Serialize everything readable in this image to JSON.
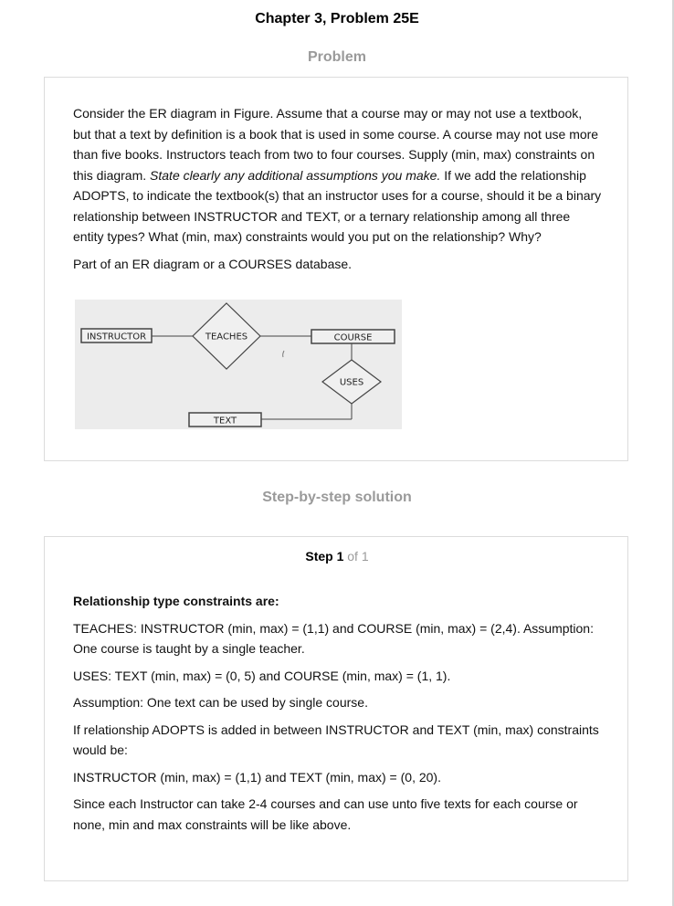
{
  "page": {
    "chapter_title": "Chapter 3, Problem 25E"
  },
  "problem": {
    "heading": "Problem",
    "text_before_italic": "Consider the ER diagram in Figure. Assume that a course may or may not use a textbook, but that a text by definition is a book that is used in some course. A course may not use more than five books. Instructors teach from two to four courses. Supply (min, max) constraints on this diagram. ",
    "text_italic": "State clearly any additional assumptions you make.",
    "text_after_italic": " If we add the relationship ADOPTS, to indicate the textbook(s) that an instructor uses for a course, should it be a binary relationship between INSTRUCTOR and TEXT, or a ternary relationship among all three entity types? What (min, max) constraints would you put on the relationship? Why?",
    "figure_caption": "Part of an ER diagram or a COURSES database.",
    "diagram": {
      "entity_instructor": "INSTRUCTOR",
      "relationship_teaches": "TEACHES",
      "entity_course": "COURSE",
      "relationship_uses": "USES",
      "entity_text": "TEXT"
    }
  },
  "solution": {
    "heading": "Step-by-step solution",
    "step_label": "Step 1",
    "step_of": " of 1",
    "subheading": "Relationship type constraints are:",
    "paragraphs": [
      "TEACHES: INSTRUCTOR (min, max) = (1,1) and COURSE (min, max) = (2,4). Assumption: One course is taught by a single teacher.",
      "USES: TEXT (min, max) = (0, 5) and COURSE (min, max) = (1, 1).",
      "Assumption: One text can be used by single course.",
      "If relationship ADOPTS is added in between INSTRUCTOR and TEXT (min, max) constraints would be:",
      "INSTRUCTOR (min, max) = (1,1) and TEXT (min, max) = (0, 20).",
      "Since each Instructor can take 2-4 courses and can use unto five texts for each course or none, min and max constraints will be like above."
    ]
  }
}
